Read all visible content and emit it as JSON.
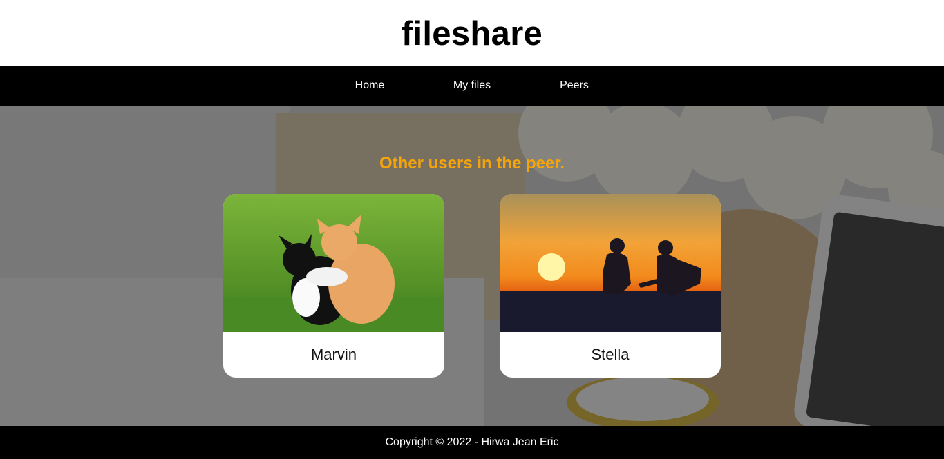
{
  "site": {
    "title": "fileshare"
  },
  "nav": {
    "items": [
      {
        "label": "Home"
      },
      {
        "label": "My files"
      },
      {
        "label": "Peers"
      }
    ]
  },
  "main": {
    "heading": "Other users in the peer.",
    "peers": [
      {
        "name": "Marvin",
        "image": "two kittens sitting on grass"
      },
      {
        "name": "Stella",
        "image": "couple silhouette at sunset with guitar"
      }
    ]
  },
  "footer": {
    "text": "Copyright © 2022 - Hirwa Jean Eric"
  },
  "colors": {
    "heading_accent": "#f5a40c",
    "bars": "#000000"
  }
}
